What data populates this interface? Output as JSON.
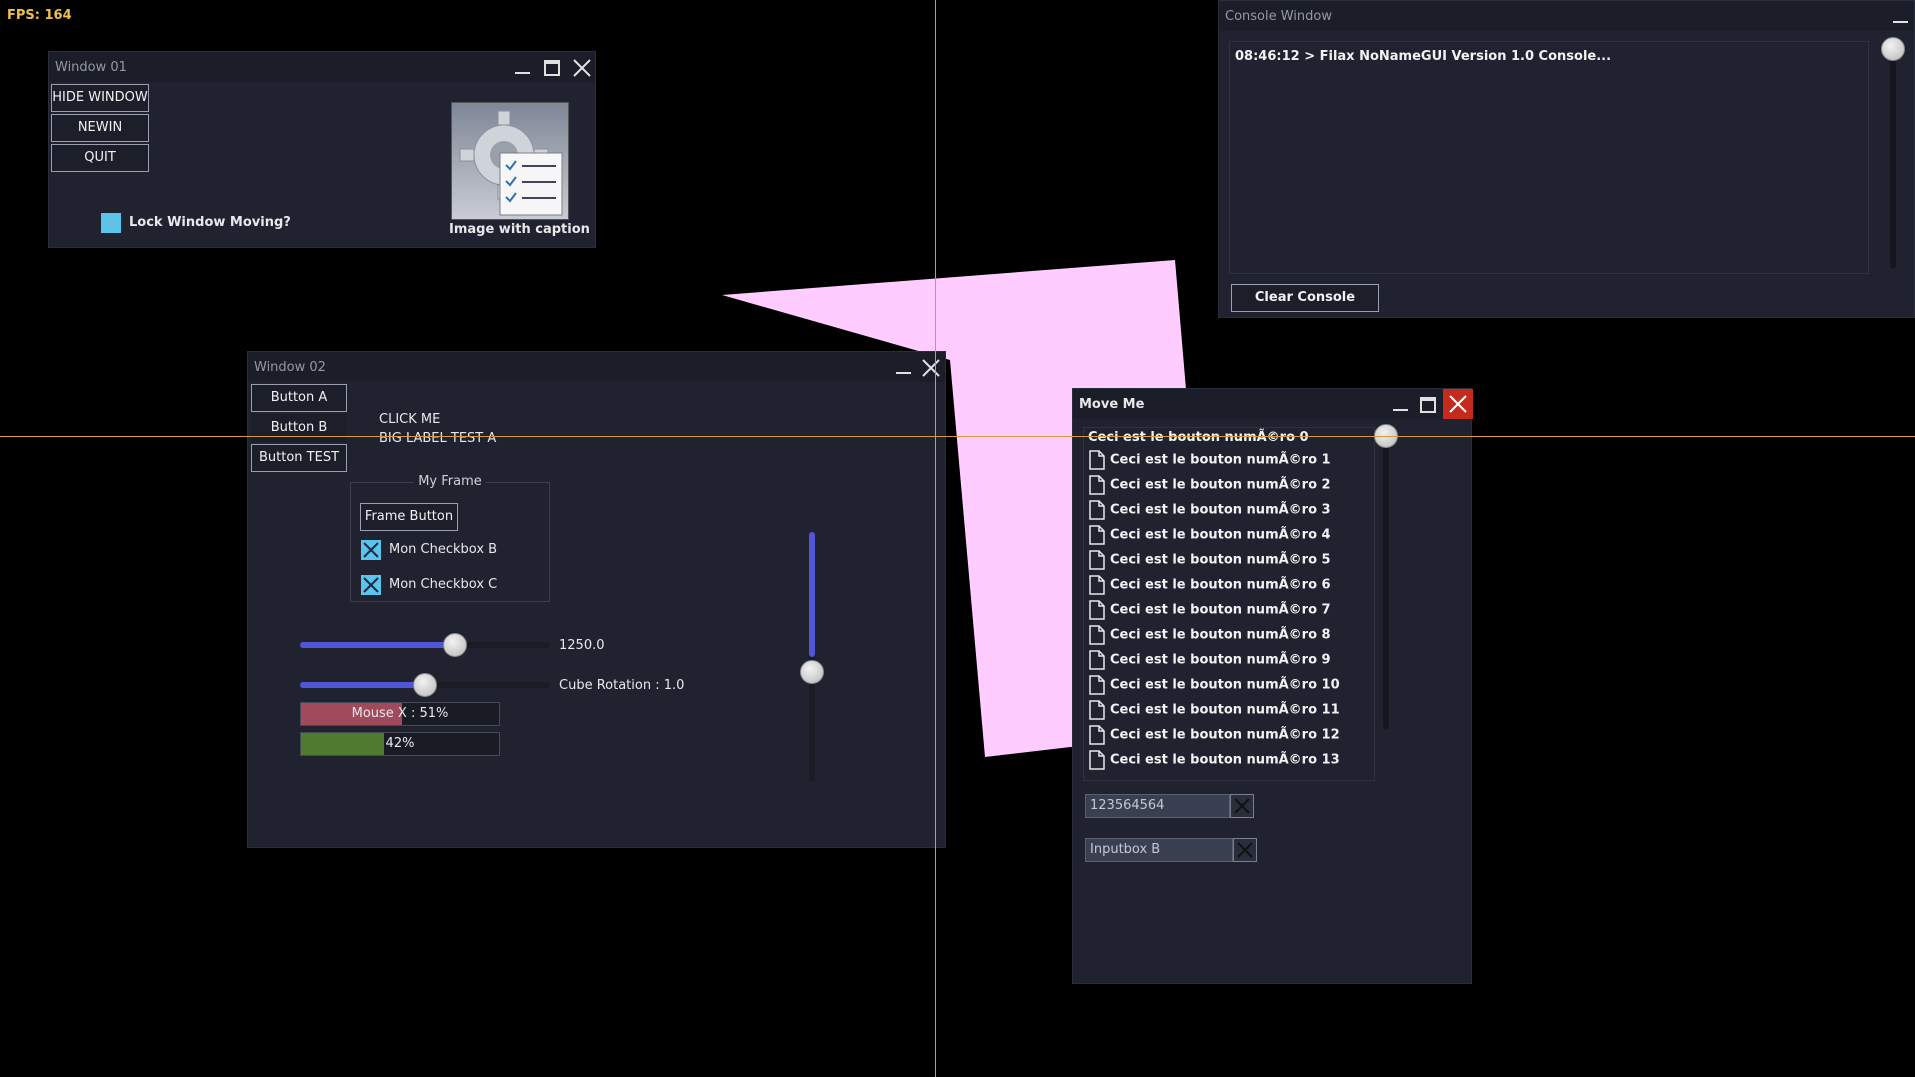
{
  "fps": "FPS: 164",
  "window01": {
    "title": "Window 01",
    "buttons": [
      "HIDE WINDOW",
      "NEWIN",
      "QUIT"
    ],
    "lock_label": "Lock Window Moving?",
    "image_caption": "Image with caption"
  },
  "window02": {
    "title": "Window 02",
    "buttons": [
      "Button A",
      "Button B",
      "Button TEST"
    ],
    "label1": "CLICK ME",
    "label2": "BIG LABEL TEST A",
    "frame_title": "My Frame",
    "frame_button": "Frame Button",
    "checkbox_b": "Mon Checkbox B",
    "checkbox_c": "Mon Checkbox C",
    "slider1_value": "1250.0",
    "slider1_fraction": 0.62,
    "slider2_label": "Cube Rotation : 1.0",
    "slider2_fraction": 0.5,
    "progress1_text": "Mouse X : 51%",
    "progress1_fraction": 0.51,
    "progress2_text": "42%",
    "progress2_fraction": 0.42,
    "vslider_fraction": 0.5
  },
  "console": {
    "title": "Console Window",
    "line": "08:46:12 > Filax NoNameGUI Version 1.0 Console...",
    "clear_label": "Clear Console"
  },
  "moveme": {
    "title": "Move Me",
    "items": [
      "Ceci est le bouton numÃ©ro 0",
      "Ceci est le bouton numÃ©ro 1",
      "Ceci est le bouton numÃ©ro 2",
      "Ceci est le bouton numÃ©ro 3",
      "Ceci est le bouton numÃ©ro 4",
      "Ceci est le bouton numÃ©ro 5",
      "Ceci est le bouton numÃ©ro 6",
      "Ceci est le bouton numÃ©ro 7",
      "Ceci est le bouton numÃ©ro 8",
      "Ceci est le bouton numÃ©ro 9",
      "Ceci est le bouton numÃ©ro 10",
      "Ceci est le bouton numÃ©ro 11",
      "Ceci est le bouton numÃ©ro 12",
      "Ceci est le bouton numÃ©ro 13"
    ],
    "input_a": "123564564",
    "input_b": "Inputbox B"
  },
  "colors": {
    "accent": "#4f56d8",
    "checkbox": "#5cc3ea",
    "progress_red": "#a04a5c",
    "progress_green": "#4f7a30",
    "close_red": "#c42b1c",
    "crosshair": "#d49a3c",
    "cube": "#ffccff"
  }
}
